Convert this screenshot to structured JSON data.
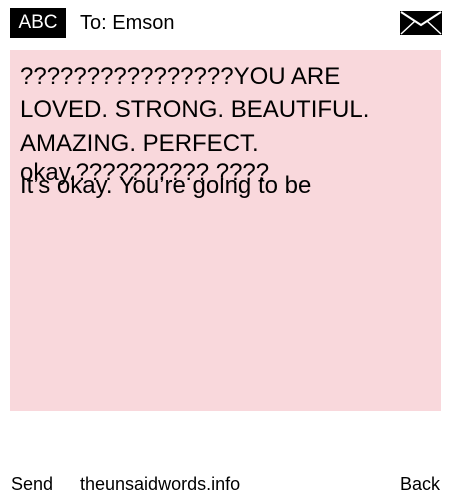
{
  "header": {
    "badge": "ABC",
    "recipient": "To: Emson",
    "mail_icon": "envelope-icon"
  },
  "message": {
    "background": "#f9d8dc",
    "lines": [
      "????????????????YOU ARE",
      "LOVED. STRONG. BEAUTIFUL.",
      "AMAZING. PERFECT.",
      "okay.?????????? ????",
      "It’s okay. You’re going to be"
    ]
  },
  "footer": {
    "send": "Send",
    "site": "theunsaidwords.info",
    "back": "Back"
  }
}
